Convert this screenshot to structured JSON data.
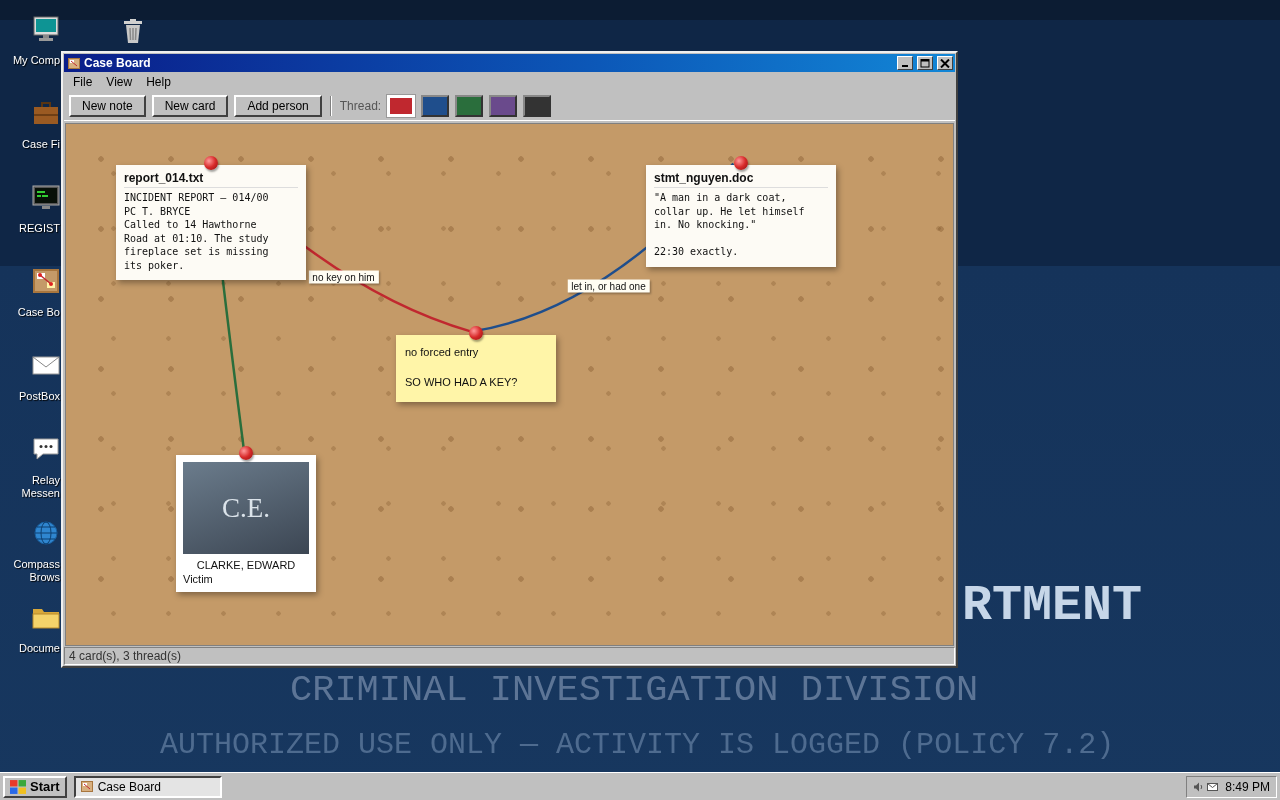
{
  "desktop": {
    "icons": [
      {
        "label": "My Comp"
      },
      {
        "label": "Case Fi"
      },
      {
        "label": "REGIST"
      },
      {
        "label": "Case Bo"
      },
      {
        "label": "PostBox"
      },
      {
        "label": "Relay\nMessen"
      },
      {
        "label": "Compass\nBrows"
      },
      {
        "label": "Docume"
      }
    ],
    "wallpaper": {
      "heading": "RTMENT",
      "subheading": "CRIMINAL INVESTIGATION DIVISION",
      "notice": "AUTHORIZED USE ONLY — ACTIVITY IS LOGGED (POLICY 7.2)"
    }
  },
  "window": {
    "title": "Case Board",
    "menu": [
      "File",
      "View",
      "Help"
    ],
    "toolbar": {
      "buttons": [
        "New note",
        "New card",
        "Add person"
      ],
      "thread_label": "Thread:",
      "swatches": [
        {
          "color": "#c0282f",
          "selected": true
        },
        {
          "color": "#1f4e8c",
          "selected": false
        },
        {
          "color": "#2a6e3c",
          "selected": false
        },
        {
          "color": "#6a4a8c",
          "selected": false
        },
        {
          "color": "#333333",
          "selected": false
        }
      ]
    },
    "cards": [
      {
        "kind": "file",
        "title": "report_014.txt",
        "body": "INCIDENT REPORT – 014/00\nPC T. BRYCE\nCalled to 14 Hawthorne Road at 01:10. The study fireplace set is missing its poker."
      },
      {
        "kind": "file",
        "title": "stmt_nguyen.doc",
        "body": "\"A man in a dark coat, collar up. He let himself in. No knocking.\"\n\n22:30 exactly."
      },
      {
        "kind": "note",
        "body": "no forced entry\n\nSO WHO HAD A KEY?"
      },
      {
        "kind": "person",
        "initials": "C.E.",
        "name": "CLARKE, EDWARD",
        "role": "Victim"
      }
    ],
    "threads": [
      {
        "color": "#c0282f",
        "label": "no key on him"
      },
      {
        "color": "#1f4e8c",
        "label": "let in, or had one"
      },
      {
        "color": "#2a6e3c"
      }
    ],
    "status_bar": "4 card(s), 3 thread(s)"
  },
  "taskbar": {
    "start": "Start",
    "tasks": [
      {
        "label": "Case Board",
        "selected": true
      }
    ],
    "clock": "8:49 PM"
  }
}
